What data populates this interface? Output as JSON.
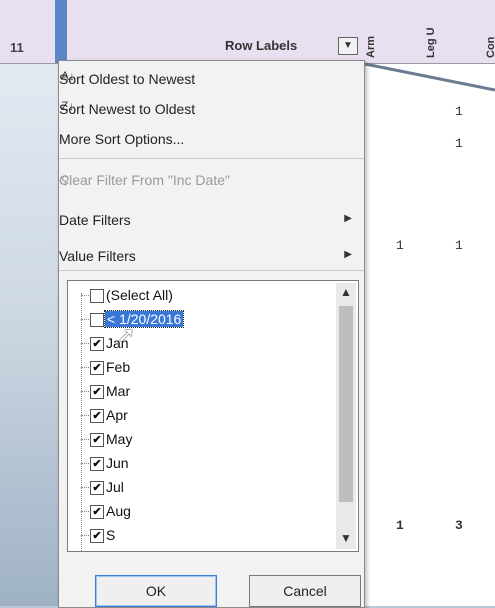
{
  "sheet": {
    "row_number": "11",
    "row_labels": "Row Labels",
    "dropdown_glyph": "▼",
    "vertical_headers": [
      "Arm",
      "Leg U",
      "Con"
    ],
    "cells": [
      {
        "text": "1"
      },
      {
        "text": "1"
      },
      {
        "text": "1"
      },
      {
        "text": "1"
      },
      {
        "text": "1"
      },
      {
        "text": "3"
      }
    ]
  },
  "menu": {
    "sort_oldest": "Sort Oldest to Newest",
    "sort_newest": "Sort Newest to Oldest",
    "more_sort": "More Sort Options...",
    "clear_filter": "Clear Filter From \"Inc Date\"",
    "date_filters": "Date Filters",
    "value_filters": "Value Filters",
    "submenu_arrow": "▶"
  },
  "list": {
    "items": [
      {
        "label": "(Select All)",
        "checked": false
      },
      {
        "label": "< 1/20/2016",
        "checked": false,
        "selected": true
      },
      {
        "label": "Jan",
        "checked": true
      },
      {
        "label": "Feb",
        "checked": true
      },
      {
        "label": "Mar",
        "checked": true
      },
      {
        "label": "Apr",
        "checked": true
      },
      {
        "label": "May",
        "checked": true
      },
      {
        "label": "Jun",
        "checked": true
      },
      {
        "label": "Jul",
        "checked": true
      },
      {
        "label": "Aug",
        "checked": true
      },
      {
        "label": "S",
        "checked": true
      }
    ],
    "check_glyph": "✔"
  },
  "buttons": {
    "ok": "OK",
    "cancel": "Cancel"
  },
  "icons": {
    "sort_asc": "sort-ascending-icon",
    "sort_desc": "sort-descending-icon",
    "clear_filter": "clear-filter-icon",
    "cursor": "mouse-pointer-icon"
  },
  "colors": {
    "selection": "#3a78d8",
    "header": "#e8e0f0",
    "row_column": "#5d86c7"
  }
}
